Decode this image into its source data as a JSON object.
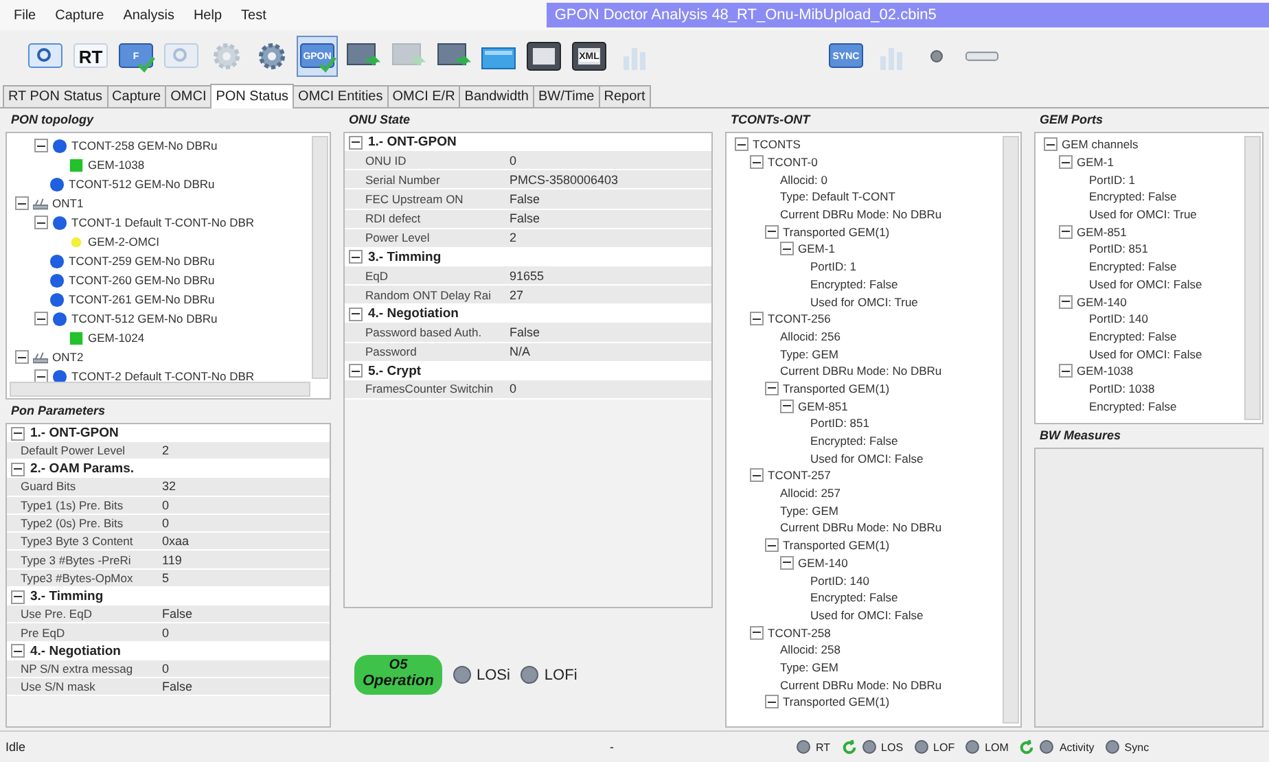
{
  "menu": [
    "File",
    "Capture",
    "Analysis",
    "Help",
    "Test"
  ],
  "window": {
    "title": "GPON Doctor Analysis 48_RT_Onu-MibUpload_02.cbin5"
  },
  "toolbar": [
    {
      "kind": "magnifier",
      "disabled": false,
      "selected": false
    },
    {
      "kind": "text",
      "label": "RT",
      "disabled": false,
      "selected": false
    },
    {
      "kind": "screen",
      "label": "F",
      "disabled": false,
      "selected": false
    },
    {
      "kind": "magnifier",
      "disabled": true,
      "selected": false
    },
    {
      "kind": "gear",
      "disabled": true,
      "selected": false
    },
    {
      "kind": "gear",
      "disabled": false,
      "selected": false
    },
    {
      "kind": "screen",
      "label": "GPON",
      "disabled": false,
      "selected": true
    },
    {
      "kind": "export",
      "disabled": false,
      "selected": false
    },
    {
      "kind": "export",
      "disabled": true,
      "selected": false
    },
    {
      "kind": "export",
      "disabled": false,
      "selected": false
    },
    {
      "kind": "folder",
      "disabled": false,
      "selected": false
    },
    {
      "kind": "frame",
      "disabled": false,
      "selected": false
    },
    {
      "kind": "frame",
      "label": "XML",
      "disabled": false,
      "selected": false
    },
    {
      "kind": "chart",
      "disabled": true,
      "selected": false
    }
  ],
  "toolbar_right": [
    {
      "kind": "screen",
      "label": "SYNC",
      "disabled": false,
      "selected": false
    },
    {
      "kind": "chart",
      "disabled": true,
      "selected": false
    },
    {
      "kind": "led",
      "disabled": false,
      "selected": false
    },
    {
      "kind": "bar",
      "disabled": false,
      "selected": false
    }
  ],
  "tabs": [
    {
      "label": "RT PON Status",
      "selected": false
    },
    {
      "label": "Capture",
      "selected": false
    },
    {
      "label": "OMCI",
      "selected": false
    },
    {
      "label": "PON Status",
      "selected": true
    },
    {
      "label": "OMCI Entities",
      "selected": false
    },
    {
      "label": "OMCI E/R",
      "selected": false
    },
    {
      "label": "Bandwidth",
      "selected": false
    },
    {
      "label": "BW/Time",
      "selected": false
    },
    {
      "label": "Report",
      "selected": false
    }
  ],
  "pon_topology": {
    "title": "PON topology",
    "partial_branch": [
      {
        "label": "TCONT-258 GEM-No DBRu",
        "kind": "tcont",
        "expanded": true,
        "children": [
          {
            "label": "GEM-1038",
            "kind": "gem"
          }
        ]
      },
      {
        "label": "TCONT-512 GEM-No DBRu",
        "kind": "tcont"
      }
    ],
    "nodes": [
      {
        "label": "ONT1",
        "kind": "ont",
        "expanded": true,
        "children": [
          {
            "label": "TCONT-1 Default T-CONT-No DBR",
            "kind": "tcont",
            "expanded": true,
            "children": [
              {
                "label": "GEM-2-OMCI",
                "kind": "omci"
              }
            ]
          },
          {
            "label": "TCONT-259 GEM-No DBRu",
            "kind": "tcont"
          },
          {
            "label": "TCONT-260 GEM-No DBRu",
            "kind": "tcont"
          },
          {
            "label": "TCONT-261 GEM-No DBRu",
            "kind": "tcont"
          },
          {
            "label": "TCONT-512 GEM-No DBRu",
            "kind": "tcont",
            "expanded": true,
            "children": [
              {
                "label": "GEM-1024",
                "kind": "gem"
              }
            ]
          }
        ]
      },
      {
        "label": "ONT2",
        "kind": "ont",
        "expanded": true,
        "children": [
          {
            "label": "TCONT-2 Default T-CONT-No DBR",
            "kind": "tcont",
            "expanded": true
          }
        ]
      }
    ]
  },
  "pon_parameters": {
    "title": "Pon Parameters",
    "sections": [
      {
        "title": "1.- ONT-GPON",
        "expanded": true,
        "rows": [
          {
            "name": "Default Power Level",
            "value": "2"
          }
        ]
      },
      {
        "title": "2.- OAM Params.",
        "expanded": true,
        "rows": [
          {
            "name": "Guard Bits",
            "value": "32"
          },
          {
            "name": "Type1 (1s) Pre. Bits",
            "value": "0"
          },
          {
            "name": "Type2 (0s) Pre. Bits",
            "value": "0"
          },
          {
            "name": "Type3 Byte 3 Content",
            "value": "0xaa"
          },
          {
            "name": "Type 3 #Bytes -PreRi",
            "value": "119"
          },
          {
            "name": "Type3 #Bytes-OpMox",
            "value": "5"
          }
        ]
      },
      {
        "title": "3.- Timming",
        "expanded": true,
        "rows": [
          {
            "name": "Use Pre. EqD",
            "value": "False"
          },
          {
            "name": "Pre EqD",
            "value": "0"
          }
        ]
      },
      {
        "title": "4.- Negotiation",
        "expanded": true,
        "rows": [
          {
            "name": "NP S/N extra messag",
            "value": "0"
          },
          {
            "name": "Use S/N mask",
            "value": "False"
          }
        ]
      }
    ]
  },
  "onu_state": {
    "title": "ONU State",
    "sections": [
      {
        "title": "1.- ONT-GPON",
        "expanded": true,
        "rows": [
          {
            "name": "ONU ID",
            "value": "0"
          },
          {
            "name": "Serial Number",
            "value": "PMCS-3580006403"
          },
          {
            "name": "FEC Upstream ON",
            "value": "False"
          },
          {
            "name": "RDI defect",
            "value": "False"
          },
          {
            "name": "Power Level",
            "value": "2"
          }
        ]
      },
      {
        "title": "3.- Timming",
        "expanded": true,
        "rows": [
          {
            "name": "EqD",
            "value": "91655"
          },
          {
            "name": "Random ONT Delay Rai",
            "value": "27"
          }
        ]
      },
      {
        "title": "4.- Negotiation",
        "expanded": true,
        "rows": [
          {
            "name": "Password based Auth.",
            "value": "False"
          },
          {
            "name": "Password",
            "value": "N/A"
          }
        ]
      },
      {
        "title": "5.- Crypt",
        "expanded": true,
        "rows": [
          {
            "name": "FramesCounter Switchin",
            "value": "0"
          }
        ]
      }
    ],
    "operation": {
      "state": "O5",
      "label": "Operation"
    },
    "leds": [
      {
        "label": "LOSi",
        "on": false
      },
      {
        "label": "LOFi",
        "on": false
      }
    ]
  },
  "tconts_ont": {
    "title": "TCONTs-ONT",
    "tree": [
      {
        "label": "TCONTS",
        "expanded": true,
        "children": [
          {
            "label": "TCONT-0",
            "expanded": true,
            "children": [
              {
                "label": "Allocid: 0"
              },
              {
                "label": "Type: Default T-CONT"
              },
              {
                "label": "Current DBRu Mode: No DBRu"
              },
              {
                "label": "Transported GEM(1)",
                "expanded": true,
                "children": [
                  {
                    "label": "GEM-1",
                    "expanded": true,
                    "children": [
                      {
                        "label": "PortID: 1"
                      },
                      {
                        "label": "Encrypted: False"
                      },
                      {
                        "label": "Used for OMCI: True"
                      }
                    ]
                  }
                ]
              }
            ]
          },
          {
            "label": "TCONT-256",
            "expanded": true,
            "children": [
              {
                "label": "Allocid: 256"
              },
              {
                "label": "Type: GEM"
              },
              {
                "label": "Current DBRu Mode: No DBRu"
              },
              {
                "label": "Transported GEM(1)",
                "expanded": true,
                "children": [
                  {
                    "label": "GEM-851",
                    "expanded": true,
                    "children": [
                      {
                        "label": "PortID: 851"
                      },
                      {
                        "label": "Encrypted: False"
                      },
                      {
                        "label": "Used for OMCI: False"
                      }
                    ]
                  }
                ]
              }
            ]
          },
          {
            "label": "TCONT-257",
            "expanded": true,
            "children": [
              {
                "label": "Allocid: 257"
              },
              {
                "label": "Type: GEM"
              },
              {
                "label": "Current DBRu Mode: No DBRu"
              },
              {
                "label": "Transported GEM(1)",
                "expanded": true,
                "children": [
                  {
                    "label": "GEM-140",
                    "expanded": true,
                    "children": [
                      {
                        "label": "PortID: 140"
                      },
                      {
                        "label": "Encrypted: False"
                      },
                      {
                        "label": "Used for OMCI: False"
                      }
                    ]
                  }
                ]
              }
            ]
          },
          {
            "label": "TCONT-258",
            "expanded": true,
            "children": [
              {
                "label": "Allocid: 258"
              },
              {
                "label": "Type: GEM"
              },
              {
                "label": "Current DBRu Mode: No DBRu"
              },
              {
                "label": "Transported GEM(1)",
                "expanded": true
              }
            ]
          }
        ]
      }
    ]
  },
  "gem_ports": {
    "title": "GEM Ports",
    "tree": [
      {
        "label": "GEM channels",
        "expanded": true,
        "children": [
          {
            "label": "GEM-1",
            "expanded": true,
            "children": [
              {
                "label": "PortID: 1"
              },
              {
                "label": "Encrypted: False"
              },
              {
                "label": "Used for OMCI: True"
              }
            ]
          },
          {
            "label": "GEM-851",
            "expanded": true,
            "children": [
              {
                "label": "PortID: 851"
              },
              {
                "label": "Encrypted: False"
              },
              {
                "label": "Used for OMCI: False"
              }
            ]
          },
          {
            "label": "GEM-140",
            "expanded": true,
            "children": [
              {
                "label": "PortID: 140"
              },
              {
                "label": "Encrypted: False"
              },
              {
                "label": "Used for OMCI: False"
              }
            ]
          },
          {
            "label": "GEM-1038",
            "expanded": true,
            "children": [
              {
                "label": "PortID: 1038"
              },
              {
                "label": "Encrypted: False"
              }
            ]
          }
        ]
      }
    ]
  },
  "bw_measures": {
    "title": "BW Measures"
  },
  "status_bar": {
    "message": "Idle",
    "center": "-",
    "indicators": [
      {
        "label": "RT",
        "on": false,
        "refresh": false
      },
      {
        "label": "LOS",
        "on": false,
        "refresh": true
      },
      {
        "label": "LOF",
        "on": false,
        "refresh": false
      },
      {
        "label": "LOM",
        "on": false,
        "refresh": false
      },
      {
        "label": "Activity",
        "on": false,
        "refresh": true
      },
      {
        "label": "Sync",
        "on": false,
        "refresh": false
      }
    ]
  }
}
